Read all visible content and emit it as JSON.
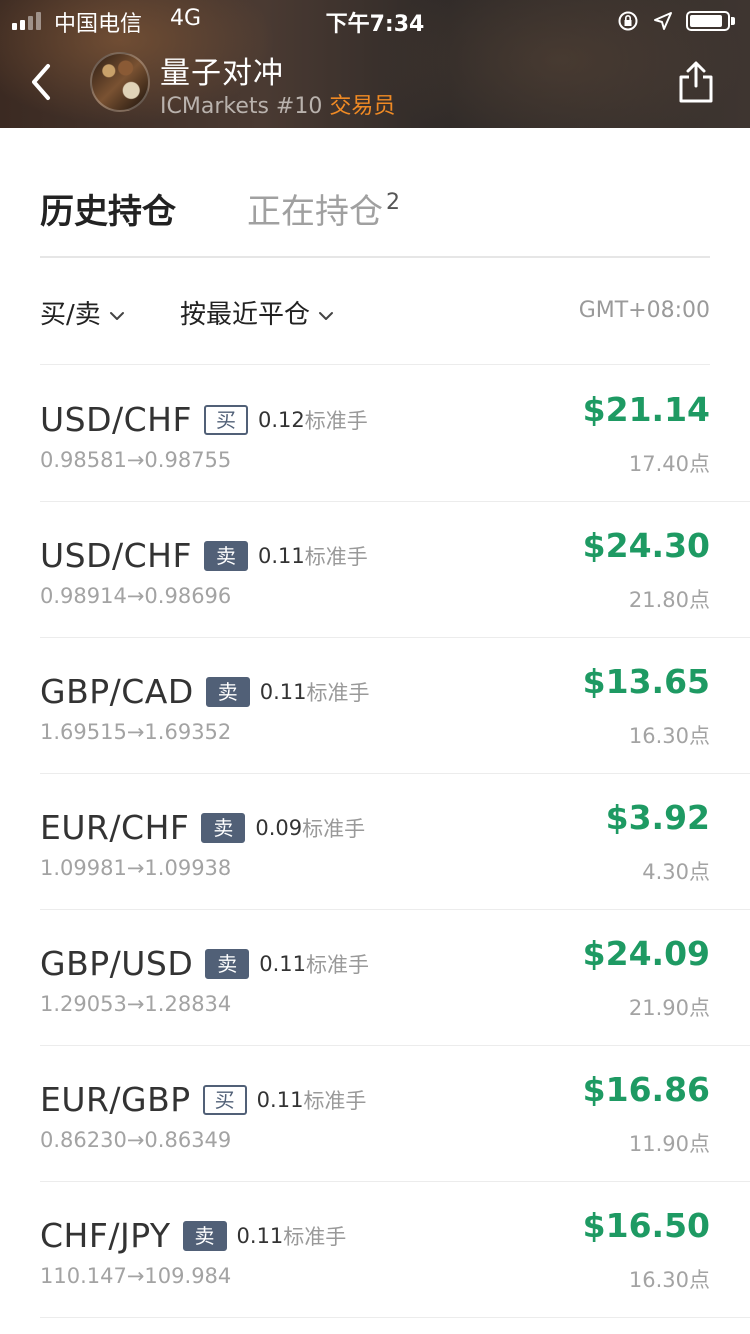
{
  "status_bar": {
    "carrier": "中国电信",
    "network": "4G",
    "time": "下午7:34"
  },
  "header": {
    "name": "量子对冲",
    "broker": "ICMarkets #10",
    "role": "交易员"
  },
  "tabs": {
    "history": "历史持仓",
    "open": "正在持仓",
    "open_count": "2"
  },
  "filters": {
    "side": "买/卖",
    "sort": "按最近平仓",
    "timezone": "GMT+08:00"
  },
  "lot_unit": "标准手",
  "trades": [
    {
      "pair": "USD/CHF",
      "side": "买",
      "type": "buy",
      "lots": "0.12",
      "prices": "0.98581→0.98755",
      "profit": "$21.14",
      "pips": "17.40点"
    },
    {
      "pair": "USD/CHF",
      "side": "卖",
      "type": "sell",
      "lots": "0.11",
      "prices": "0.98914→0.98696",
      "profit": "$24.30",
      "pips": "21.80点"
    },
    {
      "pair": "GBP/CAD",
      "side": "卖",
      "type": "sell",
      "lots": "0.11",
      "prices": "1.69515→1.69352",
      "profit": "$13.65",
      "pips": "16.30点"
    },
    {
      "pair": "EUR/CHF",
      "side": "卖",
      "type": "sell",
      "lots": "0.09",
      "prices": "1.09981→1.09938",
      "profit": "$3.92",
      "pips": "4.30点"
    },
    {
      "pair": "GBP/USD",
      "side": "卖",
      "type": "sell",
      "lots": "0.11",
      "prices": "1.29053→1.28834",
      "profit": "$24.09",
      "pips": "21.90点"
    },
    {
      "pair": "EUR/GBP",
      "side": "买",
      "type": "buy",
      "lots": "0.11",
      "prices": "0.86230→0.86349",
      "profit": "$16.86",
      "pips": "11.90点"
    },
    {
      "pair": "CHF/JPY",
      "side": "卖",
      "type": "sell",
      "lots": "0.11",
      "prices": "110.147→109.984",
      "profit": "$16.50",
      "pips": "16.30点"
    }
  ],
  "colors": {
    "profit": "#1e9a63",
    "badge": "#516077",
    "role": "#f08a24"
  }
}
